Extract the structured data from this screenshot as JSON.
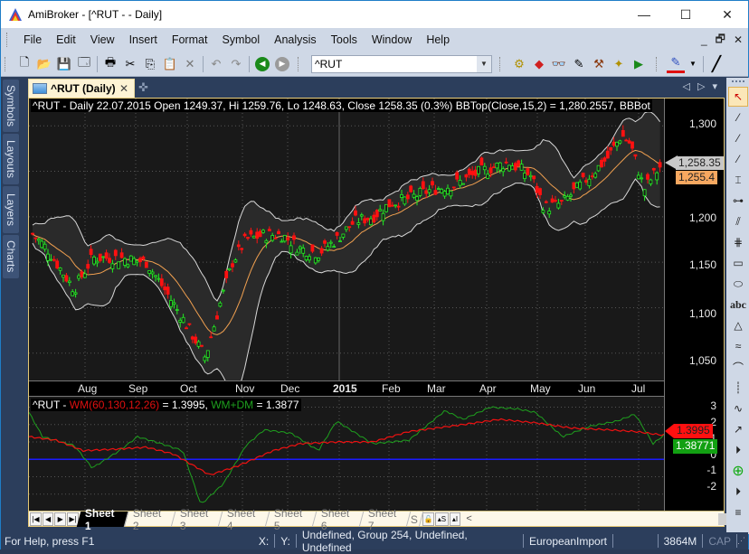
{
  "window": {
    "title": "AmiBroker - [^RUT -  - Daily]",
    "controls": {
      "minimize": "—",
      "maximize": "☐",
      "close": "✕"
    }
  },
  "menubar": {
    "items": [
      "File",
      "Edit",
      "View",
      "Insert",
      "Format",
      "Symbol",
      "Analysis",
      "Tools",
      "Window",
      "Help"
    ],
    "mdi_controls": {
      "minimize": "_",
      "restore": "🗗",
      "close": "✕"
    }
  },
  "toolbar": {
    "buttons": [
      {
        "name": "new-icon",
        "glyph": "🗋"
      },
      {
        "name": "open-icon",
        "glyph": "📂"
      },
      {
        "name": "save-icon",
        "glyph": "💾"
      },
      {
        "name": "save-all-icon",
        "glyph": "🗔"
      },
      {
        "name": "print-icon",
        "glyph": "🖶"
      },
      {
        "name": "cut-icon",
        "glyph": "✂"
      },
      {
        "name": "copy-icon",
        "glyph": "⎘"
      },
      {
        "name": "paste-icon",
        "glyph": "📋"
      },
      {
        "name": "delete-icon",
        "glyph": "✕"
      },
      {
        "name": "undo-icon",
        "glyph": "↶"
      },
      {
        "name": "redo-icon",
        "glyph": "↷"
      },
      {
        "name": "back-icon",
        "glyph": "◀"
      },
      {
        "name": "forward-icon",
        "glyph": "▶"
      }
    ],
    "symbol_value": "^RUT",
    "analysis_buttons": [
      {
        "name": "automatic-analysis-icon",
        "glyph": "⚙"
      },
      {
        "name": "portfolio-icon",
        "glyph": "◆"
      },
      {
        "name": "scan-icon",
        "glyph": "👓"
      },
      {
        "name": "formula-editor-icon",
        "glyph": "✎"
      },
      {
        "name": "optimize-icon",
        "glyph": "⚒"
      },
      {
        "name": "wizard-icon",
        "glyph": "✦"
      },
      {
        "name": "backtest-icon",
        "glyph": "▶"
      }
    ],
    "draw_buttons": [
      {
        "name": "draw-color-icon",
        "glyph": "✎"
      },
      {
        "name": "line-width-icon",
        "glyph": "╱"
      }
    ]
  },
  "left_dock": {
    "tabs": [
      "Symbols",
      "Layouts",
      "Layers",
      "Charts"
    ]
  },
  "document_tab": {
    "label": "^RUT (Daily)",
    "close": "✕",
    "new_tab": "✜",
    "nav": [
      "◁",
      "▷",
      "▾"
    ]
  },
  "chart": {
    "price_pane": {
      "title": "^RUT - Daily 22.07.2015 Open 1249.37, Hi 1259.76, Lo 1248.63, Close 1258.35 (0.3%) BBTop(Close,15,2) = 1,280.2557, BBBot",
      "y_ticks": [
        "1,300",
        "1,250",
        "1,200",
        "1,150",
        "1,100",
        "1,050"
      ],
      "y_tick_values": [
        1300,
        1250,
        1200,
        1150,
        1100,
        1050
      ],
      "last_close_tag": "1,258.35",
      "ma_tag": "1,255.4"
    },
    "date_axis": {
      "labels": [
        "Aug",
        "Sep",
        "Oct",
        "Nov",
        "Dec",
        "2015",
        "Feb",
        "Mar",
        "Apr",
        "May",
        "Jun",
        "Jul"
      ]
    },
    "indicator_pane": {
      "symbol": "^RUT - ",
      "wm_label": "WM(60,130,12,26)",
      "wm_value": " = 1.3995, ",
      "wmdm_label": "WM+DM",
      "wmdm_value": " = 1.3877",
      "y_ticks": [
        "3",
        "2",
        "1",
        "0",
        "-1",
        "-2"
      ],
      "wm_tag": "1.3995",
      "wmdm_tag": "1.38771"
    },
    "colors": {
      "up_candle": "#22ee22",
      "down_candle": "#ff1111",
      "bands": "#d8d8d8",
      "ma": "#f0a050",
      "wm": "#ee1111",
      "wmdm": "#1ea01e",
      "zero_line": "#1a1aff"
    }
  },
  "sheets": {
    "tabs": [
      "Sheet 1",
      "Sheet 2",
      "Sheet 3",
      "Sheet 4",
      "Sheet 5",
      "Sheet 6",
      "Sheet 7",
      "S"
    ],
    "active": "Sheet 1",
    "extra_buttons": [
      "🔓",
      "▴S",
      "▴I"
    ],
    "scroll_left": "<",
    "scroll_right": ">"
  },
  "right_dock": {
    "tools": [
      {
        "name": "select-arrow-icon",
        "glyph": "↖"
      },
      {
        "name": "trendline-icon",
        "glyph": "⁄"
      },
      {
        "name": "ray-icon",
        "glyph": "⁄"
      },
      {
        "name": "extended-line-icon",
        "glyph": "⁄"
      },
      {
        "name": "vertical-line-icon",
        "glyph": "⌶"
      },
      {
        "name": "horizontal-line-icon",
        "glyph": "⊶"
      },
      {
        "name": "parallel-lines-icon",
        "glyph": "⫽"
      },
      {
        "name": "andrews-pitchfork-icon",
        "glyph": "⋕"
      },
      {
        "name": "rectangle-icon",
        "glyph": "▭"
      },
      {
        "name": "ellipse-icon",
        "glyph": "⬭"
      },
      {
        "name": "text-icon",
        "glyph": "abc"
      },
      {
        "name": "triangle-icon",
        "glyph": "△"
      },
      {
        "name": "fibonacci-icon",
        "glyph": "≈"
      },
      {
        "name": "arc-icon",
        "glyph": "⌒"
      },
      {
        "name": "cycles-icon",
        "glyph": "┊"
      },
      {
        "name": "zigzag-icon",
        "glyph": "∿"
      },
      {
        "name": "arrow-icon",
        "glyph": "↗"
      },
      {
        "name": "expand-icon",
        "glyph": "⏵"
      },
      {
        "name": "zoom-icon",
        "glyph": "⊕"
      },
      {
        "name": "expand2-icon",
        "glyph": "⏵"
      },
      {
        "name": "lines-icon",
        "glyph": "≡"
      }
    ]
  },
  "statusbar": {
    "help": "For Help, press F1",
    "x_label": "X:",
    "y_label": "Y:",
    "info": "Undefined, Group 254, Undefined, Undefined",
    "db": "EuropeanImport",
    "blank": "",
    "memory": "3864M",
    "caps": "CAP"
  }
}
